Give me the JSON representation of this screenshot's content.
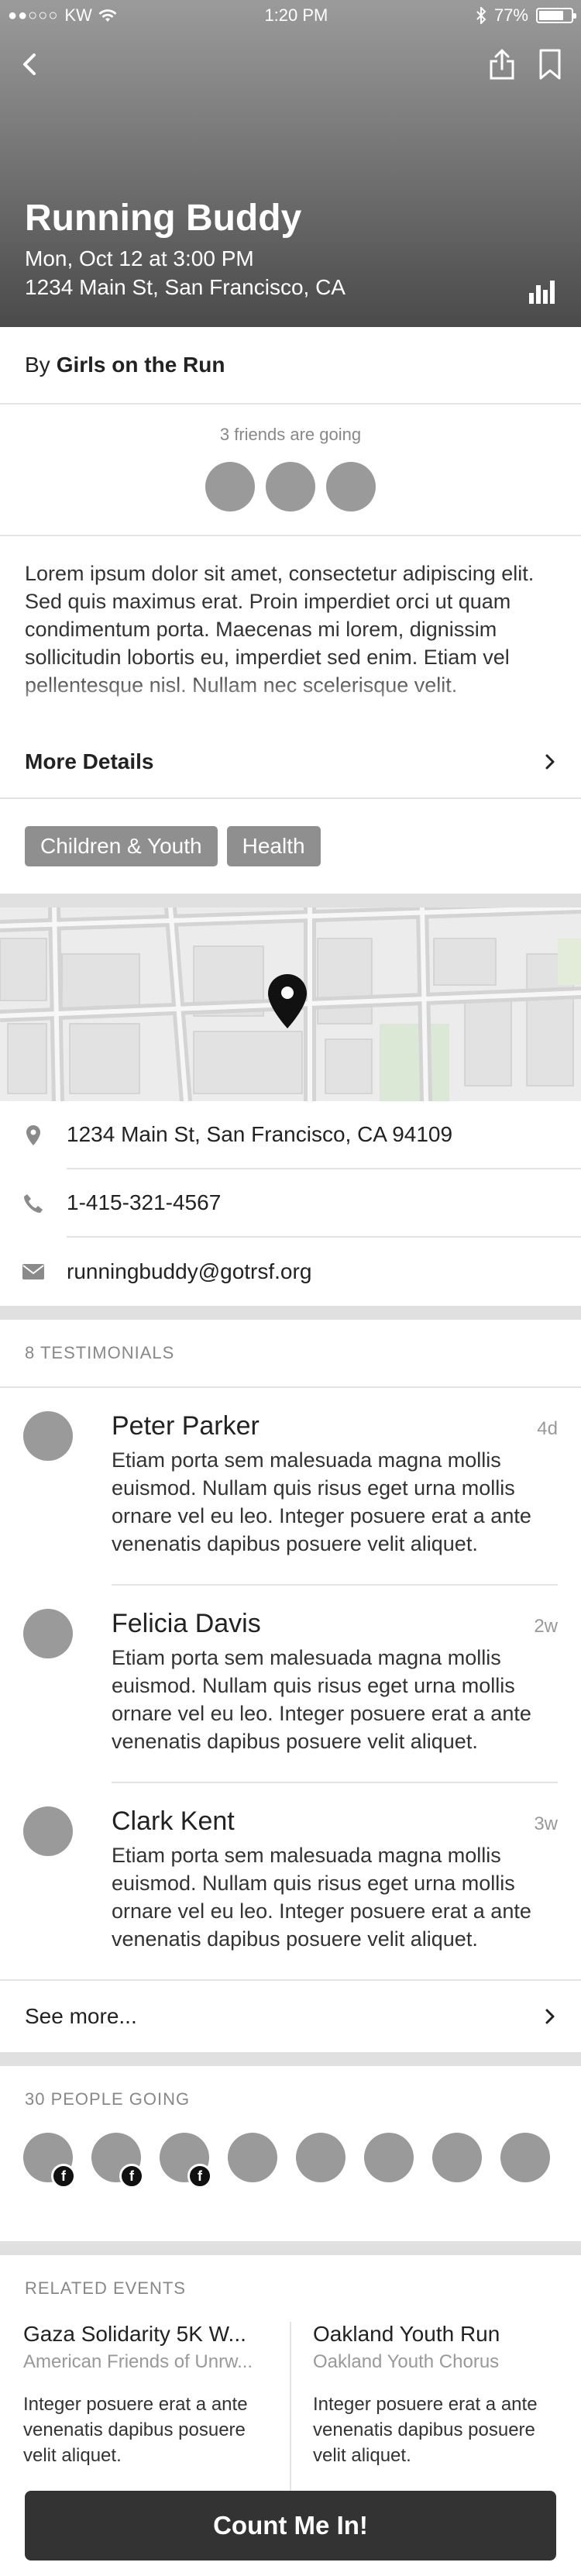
{
  "status_bar": {
    "carrier": "KW",
    "time": "1:20 PM",
    "battery": "77%"
  },
  "hero": {
    "title": "Running Buddy",
    "date": "Mon, Oct 12 at 3:00 PM",
    "address": "1234 Main St, San Francisco, CA"
  },
  "organizer": {
    "prefix": "By",
    "name": "Girls on the Run"
  },
  "friends": {
    "caption": "3 friends are going",
    "count": 3
  },
  "description": "Lorem ipsum dolor sit amet, consectetur adipiscing elit. Sed quis maximus erat. Proin imperdiet orci ut quam condimentum porta. Maecenas mi lorem, dignissim sollicitudin lobortis eu, imperdiet sed enim. Etiam vel pellentesque nisl. Nullam nec scelerisque velit.",
  "more_details": "More Details",
  "tags": [
    "Children & Youth",
    "Health"
  ],
  "contact": {
    "address": "1234 Main St, San Francisco, CA 94109",
    "phone": "1-415-321-4567",
    "email": "runningbuddy@gotrsf.org"
  },
  "testimonials": {
    "caption": "8 TESTIMONIALS",
    "items": [
      {
        "name": "Peter Parker",
        "ago": "4d",
        "text": "Etiam porta sem malesuada magna mollis euismod. Nullam quis risus eget urna mollis ornare vel eu leo. Integer posuere erat a ante venenatis dapibus posuere velit aliquet."
      },
      {
        "name": "Felicia Davis",
        "ago": "2w",
        "text": "Etiam porta sem malesuada magna mollis euismod. Nullam quis risus eget urna mollis ornare vel eu leo. Integer posuere erat a ante venenatis dapibus posuere velit aliquet."
      },
      {
        "name": "Clark Kent",
        "ago": "3w",
        "text": "Etiam porta sem malesuada magna mollis euismod. Nullam quis risus eget urna mollis ornare vel eu leo. Integer posuere erat a ante venenatis dapibus posuere velit aliquet."
      }
    ],
    "see_more": "See more..."
  },
  "going": {
    "caption": "30 PEOPLE GOING",
    "fb_badge": "f"
  },
  "related": {
    "caption": "RELATED EVENTS",
    "items": [
      {
        "title": "Gaza Solidarity 5K W...",
        "org": "American Friends of Unrw...",
        "desc": "Integer posuere erat a ante venenatis dapibus posuere velit aliquet."
      },
      {
        "title": "Oakland Youth Run",
        "org": "Oakland Youth Chorus",
        "desc": "Integer posuere erat a ante venenatis dapibus posuere velit aliquet."
      }
    ]
  },
  "cta": "Count Me In!",
  "colors": {
    "hero_top": "#9b9b9b",
    "hero_bottom": "#4a4a4a",
    "avatar": "#9a9a9a",
    "tag": "#8f8f8f",
    "cta": "#333333"
  }
}
